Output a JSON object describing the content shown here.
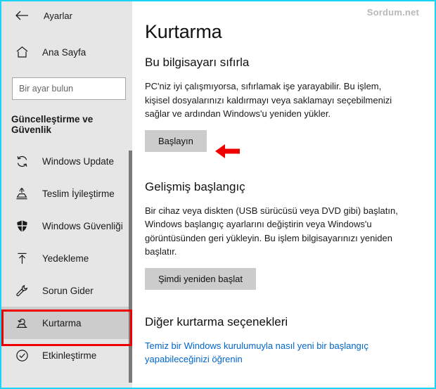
{
  "window": {
    "title": "Ayarlar",
    "back_icon": "back-arrow-icon",
    "watermark": "Sordum.net"
  },
  "sidebar": {
    "home": {
      "label": "Ana Sayfa",
      "icon": "home-icon"
    },
    "search": {
      "placeholder": "Bir ayar bulun",
      "value": "",
      "icon": "search-icon"
    },
    "category_heading": "Güncelleştirme ve Güvenlik",
    "items": [
      {
        "label": "Windows Update",
        "icon": "sync-refresh-icon",
        "selected": false
      },
      {
        "label": "Teslim İyileştirme",
        "icon": "delivery-box-icon",
        "selected": false
      },
      {
        "label": "Windows Güvenliği",
        "icon": "shield-icon",
        "selected": false
      },
      {
        "label": "Yedekleme",
        "icon": "upload-arrow-icon",
        "selected": false
      },
      {
        "label": "Sorun Gider",
        "icon": "wrench-icon",
        "selected": false
      },
      {
        "label": "Kurtarma",
        "icon": "recovery-tray-icon",
        "selected": true
      },
      {
        "label": "Etkinleştirme",
        "icon": "check-circle-icon",
        "selected": false
      }
    ],
    "scrollbar": {
      "name": "sidebar-scrollbar"
    }
  },
  "main": {
    "page_title": "Kurtarma",
    "sections": [
      {
        "title": "Bu bilgisayarı sıfırla",
        "body": "PC'niz iyi çalışmıyorsa, sıfırlamak işe yarayabilir. Bu işlem, kişisel dosyalarınızı kaldırmayı veya saklamayı seçebilmenizi sağlar ve ardından Windows'u yeniden yükler.",
        "button": "Başlayın"
      },
      {
        "title": "Gelişmiş başlangıç",
        "body": "Bir cihaz veya diskten (USB sürücüsü veya DVD gibi) başlatın, Windows başlangıç ayarlarını değiştirin veya Windows'u görüntüsünden geri yükleyin. Bu işlem bilgisayarınızı yeniden başlatır.",
        "button": "Şimdi yeniden başlat"
      },
      {
        "title": "Diğer kurtarma seçenekleri",
        "link": "Temiz bir Windows kurulumuyla nasıl yeni bir başlangıç yapabileceğinizi öğrenin"
      }
    ]
  },
  "annotations": {
    "arrow": {
      "name": "red-arrow-annotation",
      "color": "#ee0000",
      "points_to": "Başlayın"
    },
    "box": {
      "name": "red-highlight-box-annotation",
      "color": "#ee0000",
      "surrounds": "Kurtarma"
    }
  },
  "colors": {
    "accent": "#0078d7",
    "annotation": "#ee0000",
    "sidebar_bg": "#e6e6e6",
    "selected_bg": "#cccccc",
    "button_bg": "#cccccc",
    "link": "#0066cc",
    "frame": "#1ad4f5"
  }
}
